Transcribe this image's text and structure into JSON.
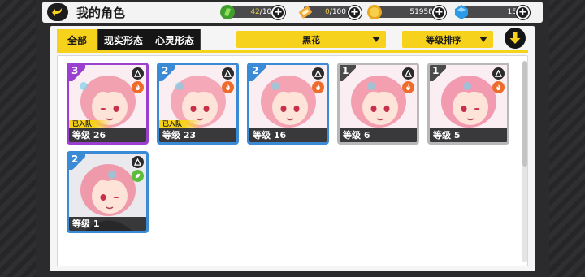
{
  "header": {
    "title": "我的角色",
    "resources": [
      {
        "name": "stamina",
        "icon": "green-stamina-icon",
        "value": "42",
        "max": "/103"
      },
      {
        "name": "ticket",
        "icon": "ticket-icon",
        "value": "0",
        "max": "/100"
      },
      {
        "name": "coins",
        "icon": "coin-icon",
        "value": "51958"
      },
      {
        "name": "gems",
        "icon": "blue-gem-icon",
        "value": "15"
      }
    ],
    "plus_label": "+"
  },
  "tabs": [
    {
      "label": "全部",
      "active": true
    },
    {
      "label": "现实形态",
      "active": false
    },
    {
      "label": "心灵形态",
      "active": false
    }
  ],
  "filter_dropdown": {
    "selected": "黑花"
  },
  "sort_dropdown": {
    "selected": "等级排序"
  },
  "cards": [
    {
      "rank": "3",
      "tier": "purple",
      "in_team": true,
      "team_label": "已入队",
      "level_label": "等级 26",
      "element": "fire"
    },
    {
      "rank": "2",
      "tier": "blue",
      "in_team": true,
      "team_label": "已入队",
      "level_label": "等级 23",
      "element": "fire"
    },
    {
      "rank": "2",
      "tier": "blue",
      "in_team": false,
      "team_label": "",
      "level_label": "等级 16",
      "element": "fire"
    },
    {
      "rank": "1",
      "tier": "gray",
      "in_team": false,
      "team_label": "",
      "level_label": "等级 6",
      "element": "fire"
    },
    {
      "rank": "1",
      "tier": "gray",
      "in_team": false,
      "team_label": "",
      "level_label": "等级 5",
      "element": "fire"
    },
    {
      "rank": "2",
      "tier": "blue",
      "in_team": false,
      "team_label": "",
      "level_label": "等级 1",
      "element": "leaf"
    }
  ],
  "colors": {
    "accent": "#f7d21c",
    "dark": "#151515",
    "blue_tier": "#3b8ad6",
    "purple_tier": "#9a3fd0",
    "gray_tier": "#b8b8b8"
  }
}
